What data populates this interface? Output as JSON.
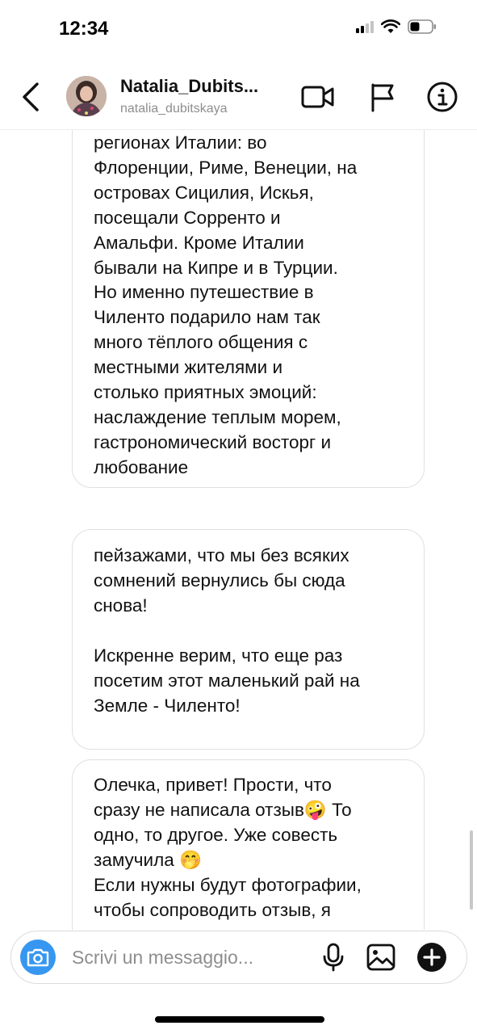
{
  "status_bar": {
    "time": "12:34"
  },
  "header": {
    "name": "Natalia_Dubits...",
    "handle": "natalia_dubitskaya"
  },
  "messages": [
    {
      "text": "регионах Италии: во\nФлоренции, Риме, Венеции, на\nостровах Сицилия, Искья,\nпосещали Сорренто и\nАмальфи. Кроме Италии\nбывали на Кипре и в Турции.\nНо именно путешествие в\nЧиленто подарило нам так\nмного тёплого общения с\nместными жителями и\nстолько приятных эмоций:\nнаслаждение теплым морем,\nгастрономический восторг и\nлюбование"
    },
    {
      "text": "пейзажами,  что мы без всяких\nсомнений вернулись бы сюда\nснова!\n\nИскренне верим, что еще раз\nпосетим этот маленький рай на\nЗемле -  Чиленто!"
    },
    {
      "text": "Олечка, привет! Прости, что\nсразу не написала отзыв🤪 То\nодно, то другое. Уже совесть\nзамучила 🤭\nЕсли нужны будут фотографии,\nчтобы сопроводить отзыв, я"
    }
  ],
  "composer": {
    "placeholder": "Scrivi un messaggio..."
  },
  "icons": {
    "back": "chevron-left-icon",
    "video": "video-camera-icon",
    "flag": "flag-icon",
    "info": "info-icon",
    "camera": "camera-icon",
    "mic": "microphone-icon",
    "gallery": "gallery-icon",
    "add": "plus-circle-icon"
  },
  "colors": {
    "accent": "#3797f0",
    "bubble_border": "#e0e0e0",
    "text": "#111111",
    "secondary_text": "#8e8e8e"
  }
}
